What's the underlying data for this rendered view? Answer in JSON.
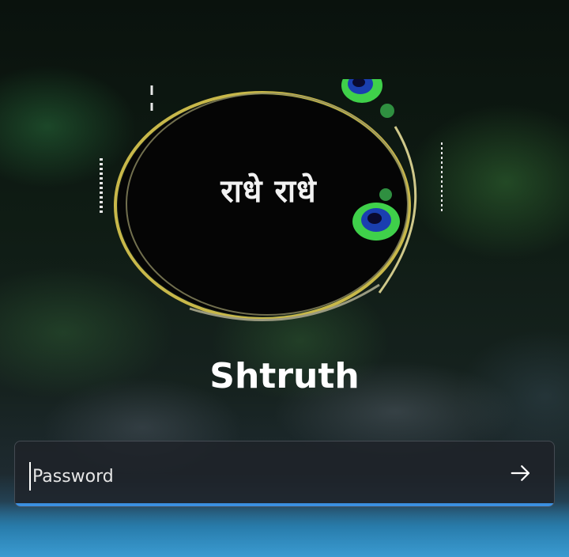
{
  "lock_screen": {
    "avatar_text": "राधे राधे",
    "username": "Shtruth",
    "password": {
      "placeholder": "Password",
      "value": ""
    },
    "submit_icon": "arrow-right-icon"
  },
  "colors": {
    "accent_underline": "#3b8fe0",
    "avatar_ring": "#c8b84a",
    "feather_green": "#3fd04a",
    "feather_blue": "#1a3fb0"
  }
}
